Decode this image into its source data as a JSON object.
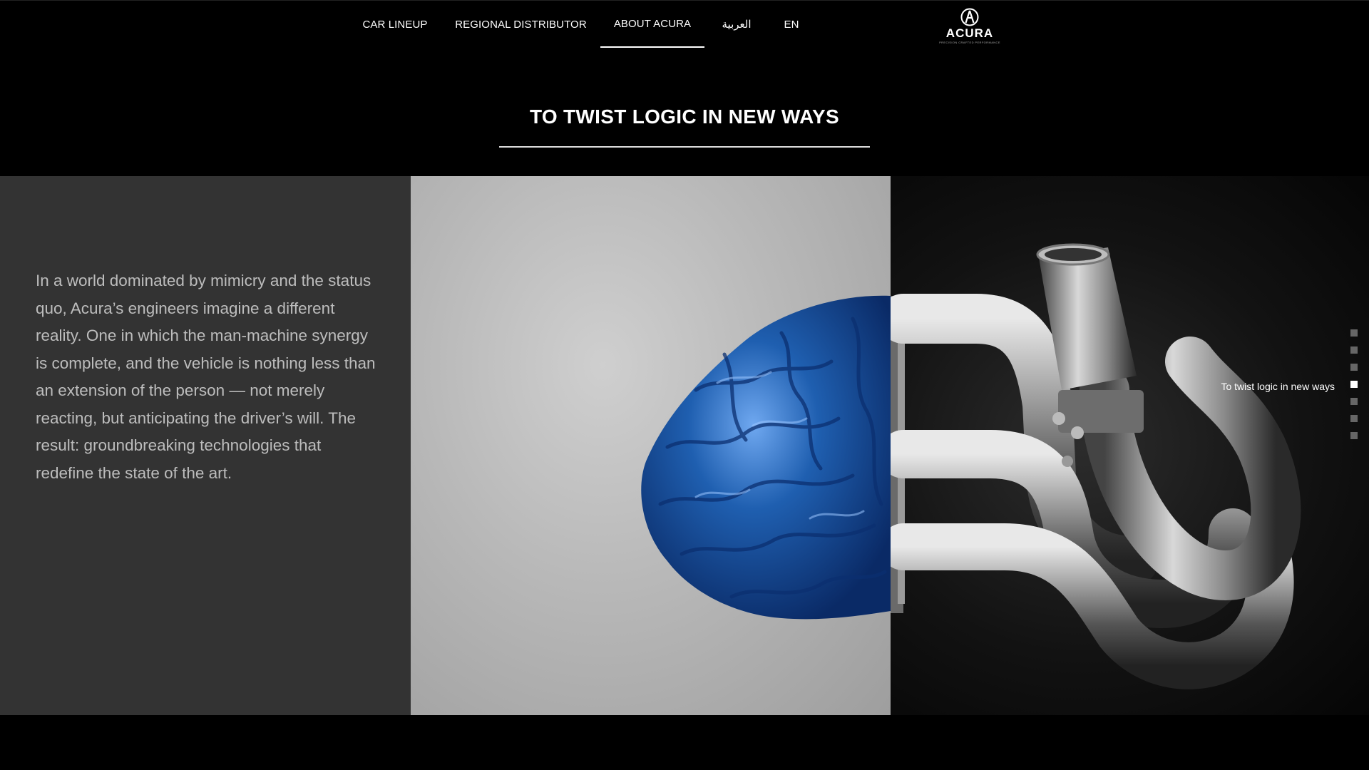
{
  "nav": {
    "items": [
      {
        "label": "CAR LINEUP"
      },
      {
        "label": "REGIONAL DISTRIBUTOR"
      },
      {
        "label": "ABOUT ACURA"
      },
      {
        "label": "العربية"
      },
      {
        "label": "EN"
      }
    ],
    "active_index": 2,
    "brand": {
      "name": "ACURA",
      "tagline": "PRECISION CRAFTED PERFORMANCE",
      "icon": "acura-logo-icon"
    }
  },
  "section": {
    "title": "TO TWIST LOGIC IN NEW WAYS",
    "body": "In a world dominated by mimicry and the status quo, Acura’s engineers imagine a different reality. One in which the man-machine synergy is complete, and the vehicle is nothing less than an extension of the person — not merely reacting, but anticipating the driver’s will. The result: groundbreaking technologies that redefine the state of the art."
  },
  "hero": {
    "left_icon": "brain-icon",
    "right_icon": "exhaust-manifold-icon"
  },
  "side_nav": {
    "active_label": "To twist logic in new ways",
    "dot_count": 7,
    "active_index": 3
  },
  "colors": {
    "background": "#000000",
    "text_panel": "#333333",
    "body_text": "#bdbdbd",
    "brain_blue": "#1f5fb0",
    "dot_inactive": "#666666",
    "dot_active": "#ffffff"
  }
}
